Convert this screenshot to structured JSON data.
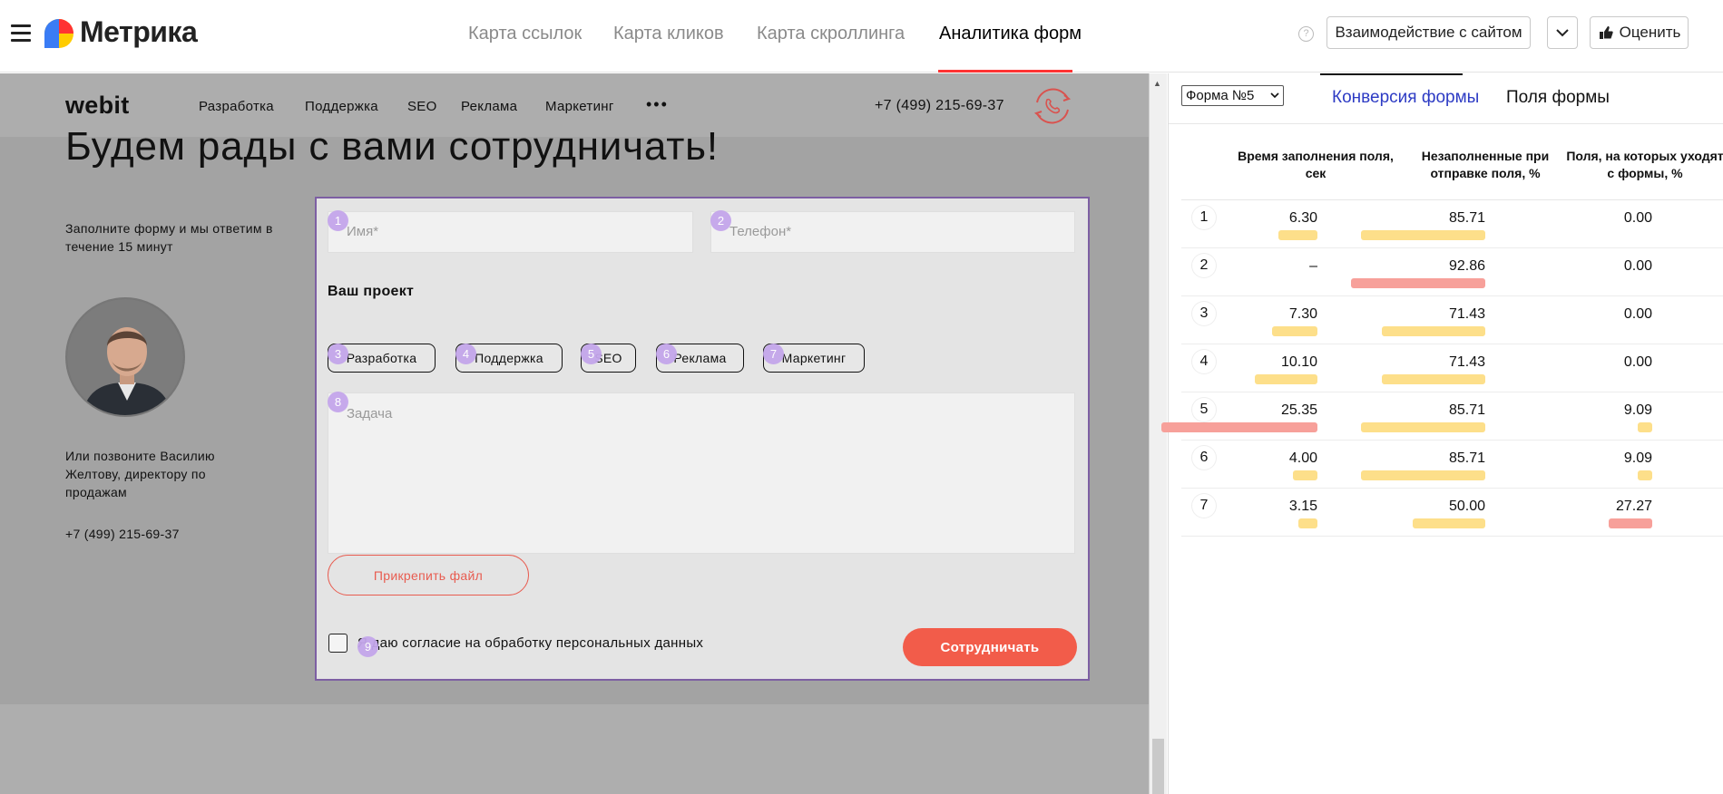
{
  "app": {
    "logo_text": "Метрика"
  },
  "nav": {
    "tabs": [
      "Карта ссылок",
      "Карта кликов",
      "Карта скроллинга",
      "Аналитика форм"
    ],
    "active_index": 3
  },
  "toolbar": {
    "interaction_label": "Взаимодействие с сайтом",
    "rate_label": "Оценить",
    "help_symbol": "?"
  },
  "site": {
    "logo": "webit",
    "menu": [
      "Разработка",
      "Поддержка",
      "SEO",
      "Реклама",
      "Маркетинг"
    ],
    "more": "•••",
    "phone": "+7 (499) 215-69-37",
    "heading": "Будем рады с вами сотрудничать!",
    "intro": "Заполните форму и мы ответим в течение 15 минут",
    "call_text": "Или позвоните Василию Желтову, директору по продажам",
    "contact_phone": "+7 (499) 215-69-37",
    "form": {
      "name_placeholder": "Имя*",
      "phone_placeholder": "Телефон*",
      "project_title": "Ваш проект",
      "chips": [
        "Разработка",
        "Поддержка",
        "SEO",
        "Реклама",
        "Маркетинг"
      ],
      "task_placeholder": "Задача",
      "attach_label": "Прикрепить файл",
      "consent": "Я даю согласие на обработку персональных данных",
      "submit": "Сотрудничать"
    },
    "field_markers": [
      "1",
      "2",
      "3",
      "4",
      "5",
      "6",
      "7",
      "8",
      "9"
    ]
  },
  "panel": {
    "form_selector": "Форма №5",
    "tabs": [
      "Конверсия формы",
      "Поля формы"
    ],
    "active_tab": 0,
    "columns": [
      "Время заполнения поля, сек",
      "Незаполненные при отправке поля, %",
      "Поля, на которых уходят с формы, %"
    ],
    "rows": [
      {
        "n": "1",
        "time": "6.30",
        "empty": "85.71",
        "leave": "0.00"
      },
      {
        "n": "2",
        "time": "–",
        "empty": "92.86",
        "leave": "0.00"
      },
      {
        "n": "3",
        "time": "7.30",
        "empty": "71.43",
        "leave": "0.00"
      },
      {
        "n": "4",
        "time": "10.10",
        "empty": "71.43",
        "leave": "0.00"
      },
      {
        "n": "5",
        "time": "25.35",
        "empty": "85.71",
        "leave": "9.09"
      },
      {
        "n": "6",
        "time": "4.00",
        "empty": "85.71",
        "leave": "9.09"
      },
      {
        "n": "7",
        "time": "3.15",
        "empty": "50.00",
        "leave": "27.27"
      }
    ],
    "colors": {
      "bar_normal": "#fddf8a",
      "bar_max": "#f7a09a"
    }
  }
}
